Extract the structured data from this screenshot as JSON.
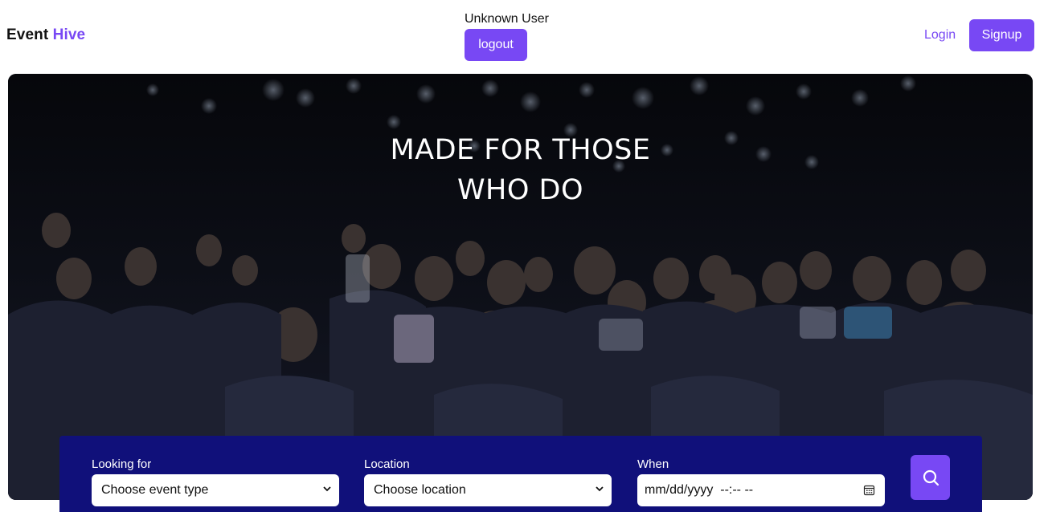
{
  "brand": {
    "part1": "Event",
    "part2": "Hive"
  },
  "user": {
    "name": "Unknown User",
    "logout_label": "logout"
  },
  "nav": {
    "login_label": "Login",
    "signup_label": "Signup"
  },
  "hero": {
    "line1": "MADE FOR THOSE",
    "line2": "WHO DO"
  },
  "search": {
    "looking_for_label": "Looking for",
    "looking_for_value": "Choose event type",
    "location_label": "Location",
    "location_value": "Choose location",
    "when_label": "When",
    "when_value": "mm/dd/yyyy  --:-- --"
  },
  "colors": {
    "accent": "#7848F4",
    "panel": "#10107A",
    "brand_dark": "#111111"
  },
  "icons": [
    "chevron-down-icon",
    "calendar-icon",
    "search-icon"
  ]
}
